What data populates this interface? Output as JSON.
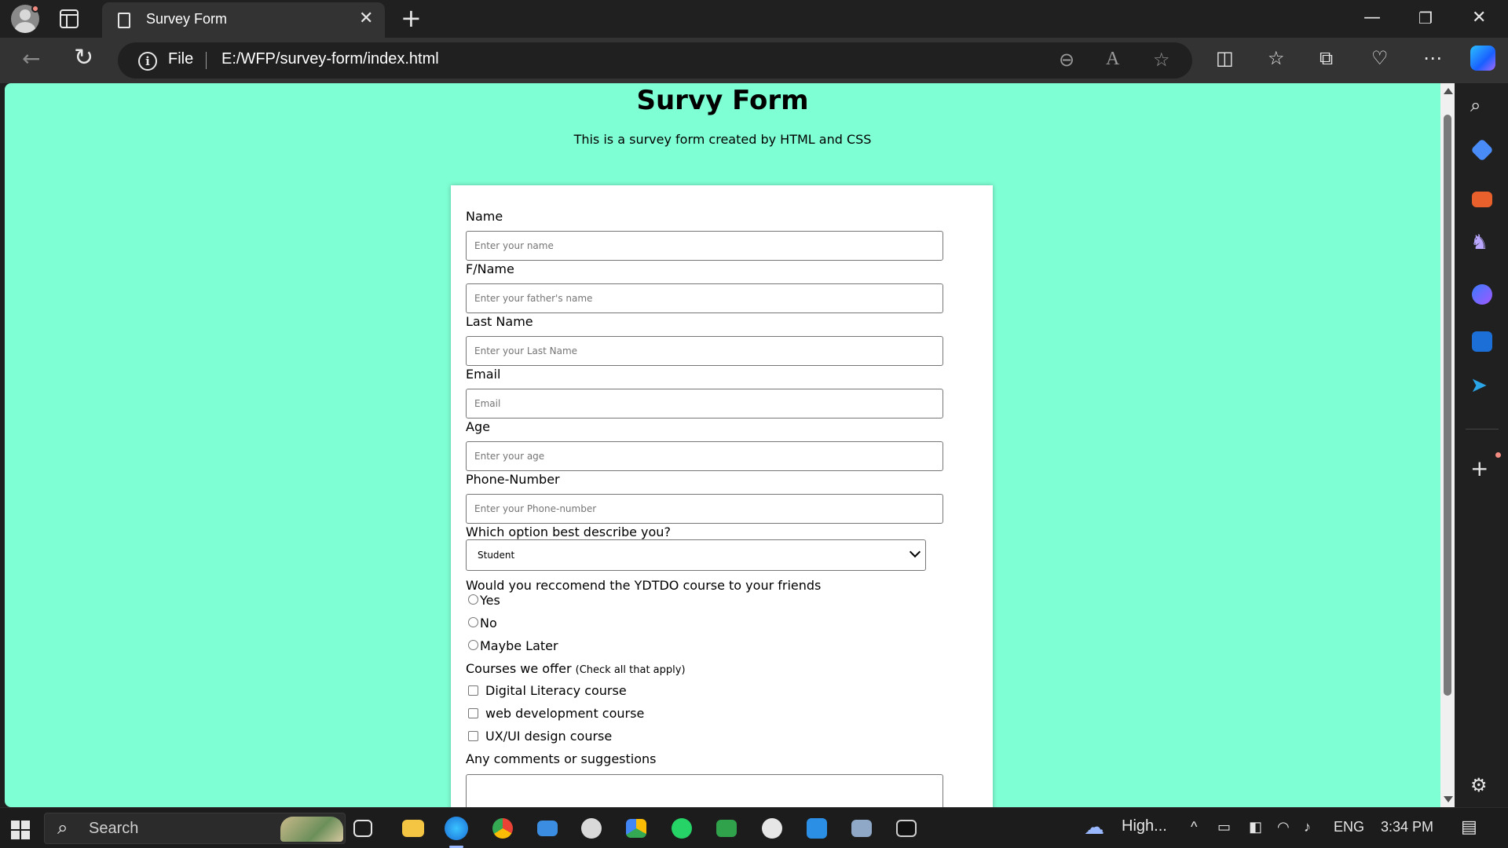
{
  "browser": {
    "tab_title": "Survey Form",
    "address_scheme_label": "File",
    "url": "E:/WFP/survey-form/index.html"
  },
  "page": {
    "heading": "Survy Form",
    "description": "This is a survey form created by HTML and CSS",
    "fields": [
      {
        "label": "Name",
        "placeholder": "Enter your name"
      },
      {
        "label": "F/Name",
        "placeholder": "Enter your father's name"
      },
      {
        "label": "Last Name",
        "placeholder": "Enter your Last Name"
      },
      {
        "label": "Email",
        "placeholder": "Email"
      },
      {
        "label": "Age",
        "placeholder": "Enter your age"
      },
      {
        "label": "Phone-Number",
        "placeholder": "Enter your Phone-number"
      }
    ],
    "select": {
      "label": "Which option best describe you?",
      "value": "Student"
    },
    "recommend": {
      "label": "Would you reccomend the YDTDO course to your friends",
      "options": [
        "Yes",
        "No",
        "Maybe Later"
      ]
    },
    "courses": {
      "label": "Courses we offer",
      "hint": "(Check all that apply)",
      "options": [
        "Digital Literacy course",
        "web development course",
        "UX/UI design course"
      ]
    },
    "comments": {
      "label": "Any comments or suggestions"
    }
  },
  "taskbar": {
    "search_label": "Search",
    "weather": "High...",
    "language": "ENG",
    "time": "3:34 PM"
  },
  "colors": {
    "page_background": "#7fffd4",
    "form_background": "#ffffff",
    "browser_chrome": "#202020"
  },
  "icons": {
    "tab": "page-icon",
    "address": "info-icon",
    "sidebar": [
      "search-icon",
      "tag-icon",
      "toolbox-icon",
      "chess-icon",
      "copilot-icon",
      "outlook-icon",
      "send-icon",
      "add-icon",
      "gear-icon"
    ]
  }
}
